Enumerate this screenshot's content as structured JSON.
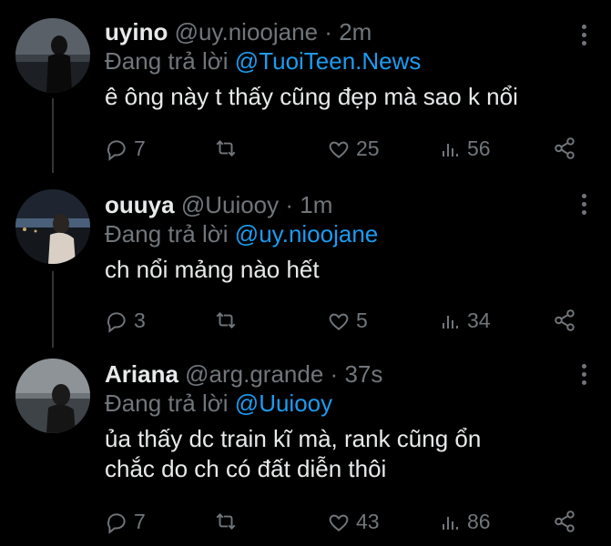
{
  "tweets": [
    {
      "name": "uyino",
      "handle": "@uy.nioojane",
      "dot": "·",
      "time": "2m",
      "reply_prefix": "Đang trả lời",
      "reply_to": "@TuoiTeen.News",
      "text": "ê ông này t thấy cũng đẹp mà sao k nổi",
      "replies": "7",
      "retweets": "",
      "likes": "25",
      "views": "56"
    },
    {
      "name": "ouuya",
      "handle": "@Uuiooy",
      "dot": "·",
      "time": "1m",
      "reply_prefix": "Đang trả lời",
      "reply_to": "@uy.nioojane",
      "text": "ch nổi mảng nào hết",
      "replies": "3",
      "retweets": "",
      "likes": "5",
      "views": "34"
    },
    {
      "name": "Ariana",
      "handle": "@arg.grande",
      "dot": "·",
      "time": "37s",
      "reply_prefix": "Đang trả lời",
      "reply_to": "@Uuiooy",
      "text_line1": "ủa thấy dc train kĩ mà, rank cũng ổn",
      "text_line2": "chắc do ch có đất diễn thôi",
      "replies": "7",
      "retweets": "",
      "likes": "43",
      "views": "86"
    }
  ],
  "colors": {
    "background": "#000000",
    "text": "#e7e9ea",
    "secondary": "#71767b",
    "mention": "#1d9bf0"
  },
  "icons": [
    "reply-icon",
    "retweet-icon",
    "like-icon",
    "views-icon",
    "share-icon",
    "more-icon"
  ]
}
